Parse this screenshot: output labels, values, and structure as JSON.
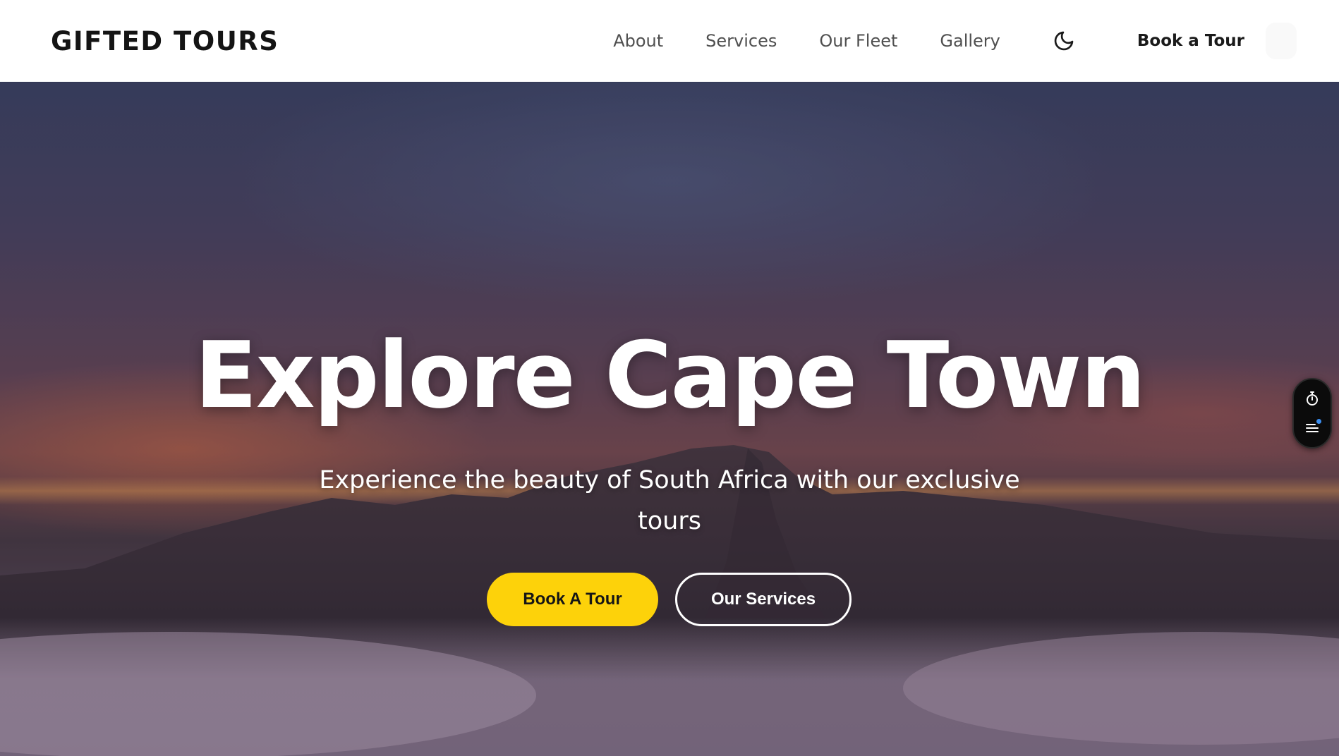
{
  "brand": {
    "logo": "GIFTED TOURS"
  },
  "nav": {
    "links": [
      "About",
      "Services",
      "Our Fleet",
      "Gallery"
    ],
    "theme_icon": "moon-icon",
    "cta": "Book a Tour"
  },
  "hero": {
    "title": "Explore Cape Town",
    "subtitle": "Experience the beauty of South Africa with our exclusive tours",
    "primary_button": "Book A Tour",
    "secondary_button": "Our Services"
  },
  "side_widget": {
    "icons": [
      "stopwatch-icon",
      "menu-list-icon"
    ]
  },
  "colors": {
    "accent": "#fdd20a",
    "header_bg": "#ffffff",
    "text_dark": "#141414",
    "nav_text": "#4f4f4f",
    "notification_dot": "#3b8ef0"
  }
}
